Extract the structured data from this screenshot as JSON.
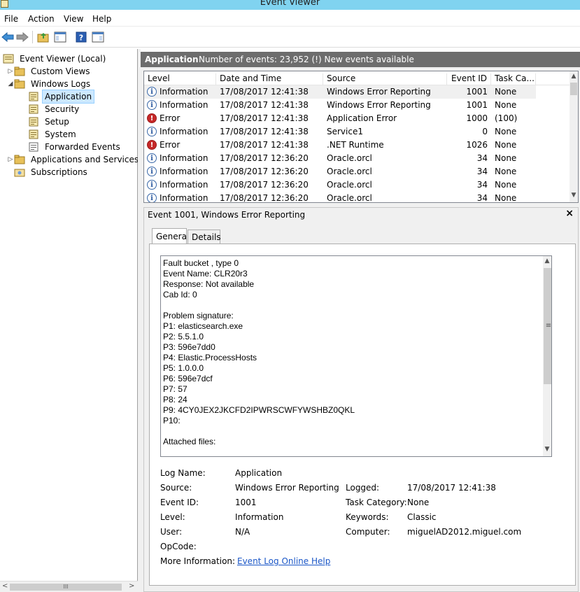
{
  "window": {
    "title": "Event Viewer"
  },
  "menu": [
    "File",
    "Action",
    "View",
    "Help"
  ],
  "toolbar": {
    "icons": [
      "back-arrow-icon",
      "forward-arrow-icon",
      "folder-up-icon",
      "show-hide-tree-icon",
      "help-icon",
      "show-hide-action-pane-icon"
    ]
  },
  "tree": {
    "root": "Event Viewer (Local)",
    "custom_views": "Custom Views",
    "windows_logs": "Windows Logs",
    "logs": [
      "Application",
      "Security",
      "Setup",
      "System",
      "Forwarded Events"
    ],
    "apps_services": "Applications and Services Lo",
    "subscriptions": "Subscriptions",
    "scroll_thumb": "III"
  },
  "header": {
    "log_name": "Application",
    "events_info": "Number of events: 23,952 (!) New events available"
  },
  "grid": {
    "columns": [
      "Level",
      "Date and Time",
      "Source",
      "Event ID",
      "Task Ca..."
    ],
    "rows": [
      {
        "level": "Information",
        "type": "info",
        "datetime": "17/08/2017 12:41:38",
        "source": "Windows Error Reporting",
        "event_id": "1001",
        "task": "None"
      },
      {
        "level": "Information",
        "type": "info",
        "datetime": "17/08/2017 12:41:38",
        "source": "Windows Error Reporting",
        "event_id": "1001",
        "task": "None"
      },
      {
        "level": "Error",
        "type": "error",
        "datetime": "17/08/2017 12:41:38",
        "source": "Application Error",
        "event_id": "1000",
        "task": "(100)"
      },
      {
        "level": "Information",
        "type": "info",
        "datetime": "17/08/2017 12:41:38",
        "source": "Service1",
        "event_id": "0",
        "task": "None"
      },
      {
        "level": "Error",
        "type": "error",
        "datetime": "17/08/2017 12:41:38",
        "source": ".NET Runtime",
        "event_id": "1026",
        "task": "None"
      },
      {
        "level": "Information",
        "type": "info",
        "datetime": "17/08/2017 12:36:20",
        "source": "Oracle.orcl",
        "event_id": "34",
        "task": "None"
      },
      {
        "level": "Information",
        "type": "info",
        "datetime": "17/08/2017 12:36:20",
        "source": "Oracle.orcl",
        "event_id": "34",
        "task": "None"
      },
      {
        "level": "Information",
        "type": "info",
        "datetime": "17/08/2017 12:36:20",
        "source": "Oracle.orcl",
        "event_id": "34",
        "task": "None"
      },
      {
        "level": "Information",
        "type": "info",
        "datetime": "17/08/2017 12:36:20",
        "source": "Oracle.orcl",
        "event_id": "34",
        "task": "None"
      }
    ]
  },
  "detail": {
    "title": "Event 1001, Windows Error Reporting",
    "close": "×",
    "tabs": [
      "General",
      "Details"
    ],
    "description": "Fault bucket , type 0\nEvent Name: CLR20r3\nResponse: Not available\nCab Id: 0\n\nProblem signature:\nP1: elasticsearch.exe\nP2: 5.5.1.0\nP3: 596e7dd0\nP4: Elastic.ProcessHosts\nP5: 1.0.0.0\nP6: 596e7dcf\nP7: 57\nP8: 24\nP9: 4CY0JEX2JKCFD2IPWRSCWFYWSHBZ0QKL\nP10:\n\nAttached files:",
    "scroll_thumb": "≡",
    "props": {
      "log_name_label": "Log Name:",
      "log_name": "Application",
      "source_label": "Source:",
      "source": "Windows Error Reporting",
      "logged_label": "Logged:",
      "logged": "17/08/2017 12:41:38",
      "event_id_label": "Event ID:",
      "event_id": "1001",
      "task_category_label": "Task Category:",
      "task_category": "None",
      "level_label": "Level:",
      "level": "Information",
      "keywords_label": "Keywords:",
      "keywords": "Classic",
      "user_label": "User:",
      "user": "N/A",
      "computer_label": "Computer:",
      "computer": "miguelAD2012.miguel.com",
      "opcode_label": "OpCode:",
      "more_info_label": "More Information:",
      "more_info_link": "Event Log Online Help"
    }
  }
}
